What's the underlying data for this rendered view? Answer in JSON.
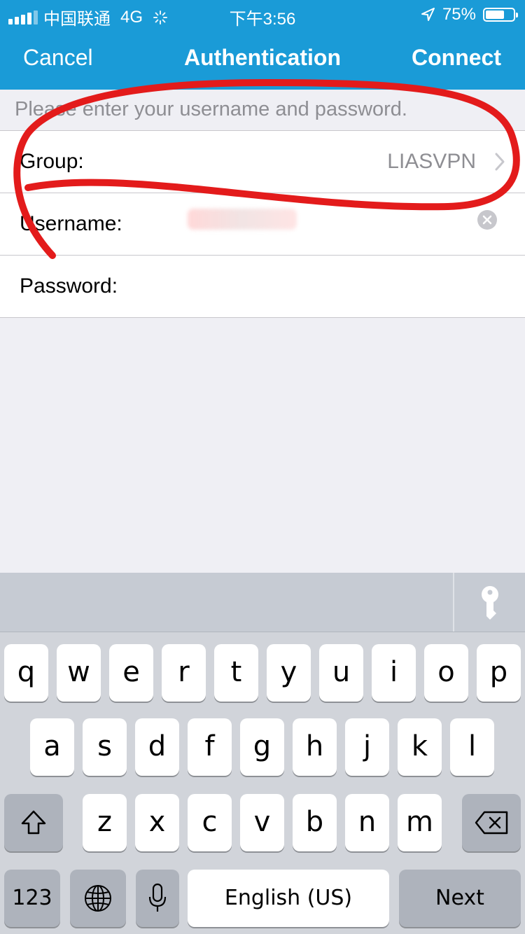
{
  "status_bar": {
    "carrier": "中国联通",
    "network": "4G",
    "time": "下午3:56",
    "battery": "75%",
    "battery_level": 0.75
  },
  "nav": {
    "cancel": "Cancel",
    "title": "Authentication",
    "connect": "Connect"
  },
  "prompt": "Please enter your username and password.",
  "form": {
    "group_label": "Group:",
    "group_value": "LIASVPN",
    "username_label": "Username:",
    "password_label": "Password:"
  },
  "keyboard": {
    "row1": [
      "q",
      "w",
      "e",
      "r",
      "t",
      "y",
      "u",
      "i",
      "o",
      "p"
    ],
    "row2": [
      "a",
      "s",
      "d",
      "f",
      "g",
      "h",
      "j",
      "k",
      "l"
    ],
    "row3": [
      "z",
      "x",
      "c",
      "v",
      "b",
      "n",
      "m"
    ],
    "numbers_key": "123",
    "space_key": "English (US)",
    "return_key": "Next"
  },
  "icons": {
    "annotation_color": "#e31b1b",
    "accent": "#1a9bd7"
  }
}
